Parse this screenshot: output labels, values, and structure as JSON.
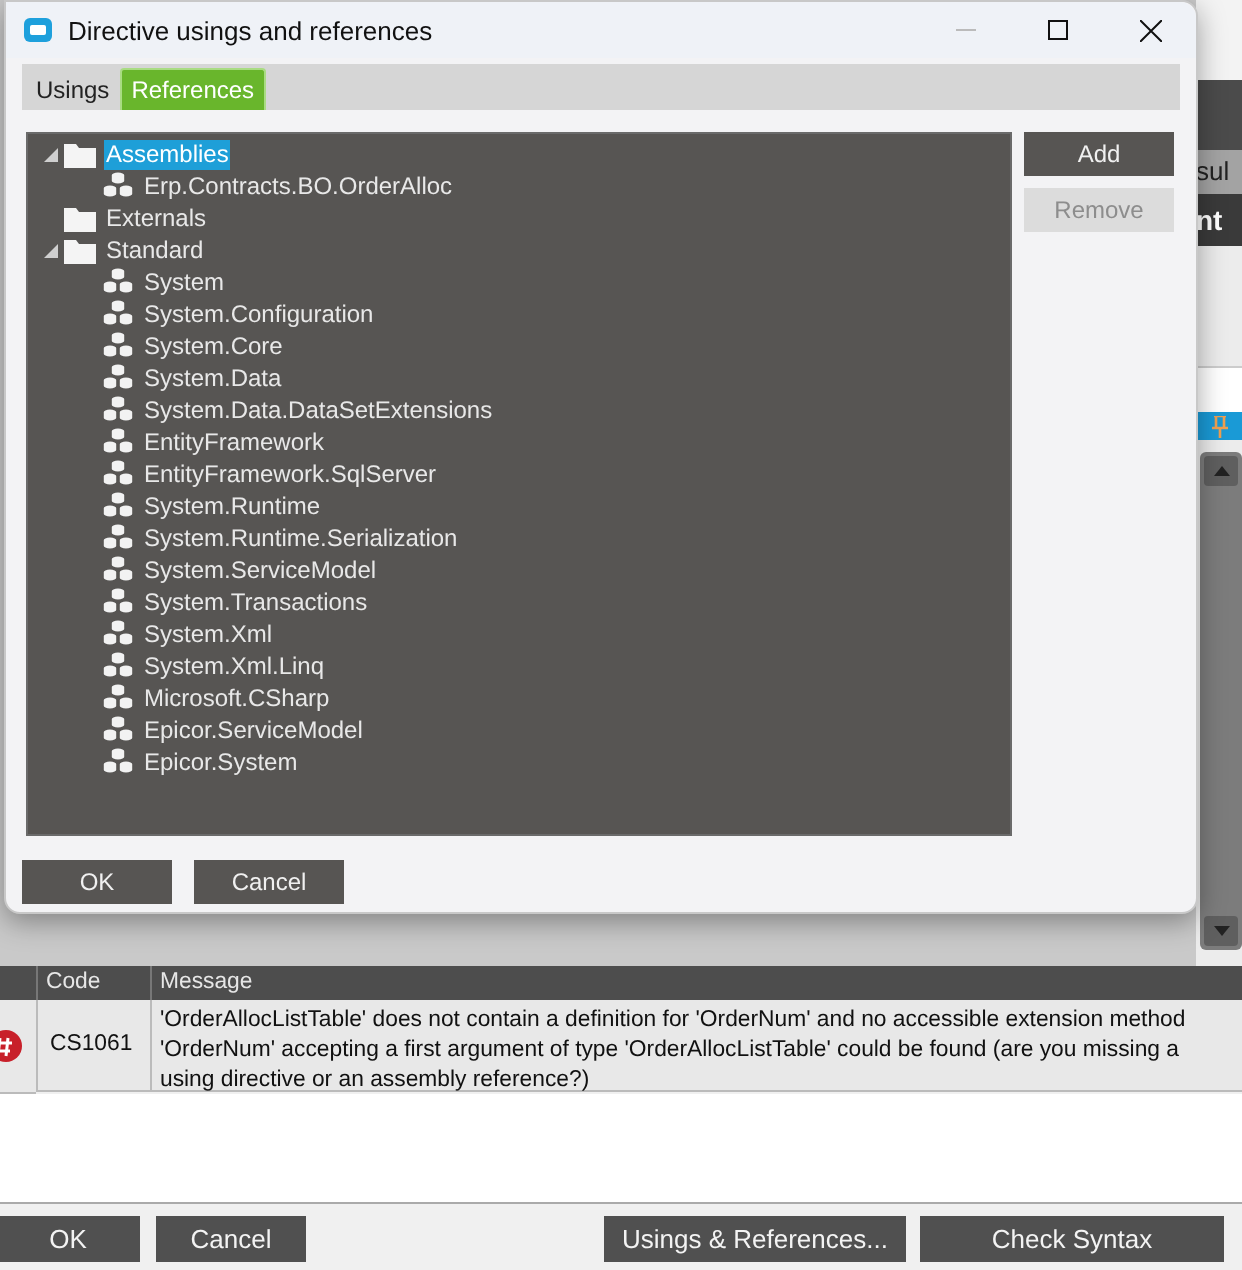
{
  "window": {
    "title": "Directive usings and references"
  },
  "tabs": [
    {
      "label": "Usings",
      "selected": false
    },
    {
      "label": "References",
      "selected": true
    }
  ],
  "tree": [
    {
      "label": "Assemblies",
      "kind": "folder",
      "expanded": true,
      "selected": true,
      "children": [
        {
          "label": "Erp.Contracts.BO.OrderAlloc",
          "kind": "assembly",
          "selected": false
        }
      ]
    },
    {
      "label": "Externals",
      "kind": "folder",
      "expanded": false,
      "selected": false
    },
    {
      "label": "Standard",
      "kind": "folder",
      "expanded": true,
      "selected": false,
      "children": [
        {
          "label": "System",
          "kind": "assembly",
          "selected": false
        },
        {
          "label": "System.Configuration",
          "kind": "assembly",
          "selected": false
        },
        {
          "label": "System.Core",
          "kind": "assembly",
          "selected": false
        },
        {
          "label": "System.Data",
          "kind": "assembly",
          "selected": false
        },
        {
          "label": "System.Data.DataSetExtensions",
          "kind": "assembly",
          "selected": false
        },
        {
          "label": "EntityFramework",
          "kind": "assembly",
          "selected": false
        },
        {
          "label": "EntityFramework.SqlServer",
          "kind": "assembly",
          "selected": false
        },
        {
          "label": "System.Runtime",
          "kind": "assembly",
          "selected": false
        },
        {
          "label": "System.Runtime.Serialization",
          "kind": "assembly",
          "selected": false
        },
        {
          "label": "System.ServiceModel",
          "kind": "assembly",
          "selected": false
        },
        {
          "label": "System.Transactions",
          "kind": "assembly",
          "selected": false
        },
        {
          "label": "System.Xml",
          "kind": "assembly",
          "selected": false
        },
        {
          "label": "System.Xml.Linq",
          "kind": "assembly",
          "selected": false
        },
        {
          "label": "Microsoft.CSharp",
          "kind": "assembly",
          "selected": false
        },
        {
          "label": "Epicor.ServiceModel",
          "kind": "assembly",
          "selected": false
        },
        {
          "label": "Epicor.System",
          "kind": "assembly",
          "selected": false
        }
      ]
    }
  ],
  "side_buttons": [
    {
      "label": "Add",
      "disabled": false
    },
    {
      "label": "Remove",
      "disabled": true
    }
  ],
  "dialog_buttons": [
    "OK",
    "Cancel"
  ],
  "background": {
    "tab_fragments": [
      "sul",
      "nt"
    ],
    "errors": {
      "columns": [
        "Code",
        "Message"
      ],
      "rows": [
        {
          "kind": "error",
          "code": "CS1061",
          "message": "'OrderAllocListTable' does not contain a definition for 'OrderNum' and no accessible extension method 'OrderNum' accepting a first argument of type 'OrderAllocListTable' could be found (are you missing a using directive or an assembly reference?)"
        }
      ]
    },
    "buttons": [
      "OK",
      "Cancel",
      "Usings & References...",
      "Check Syntax"
    ]
  }
}
